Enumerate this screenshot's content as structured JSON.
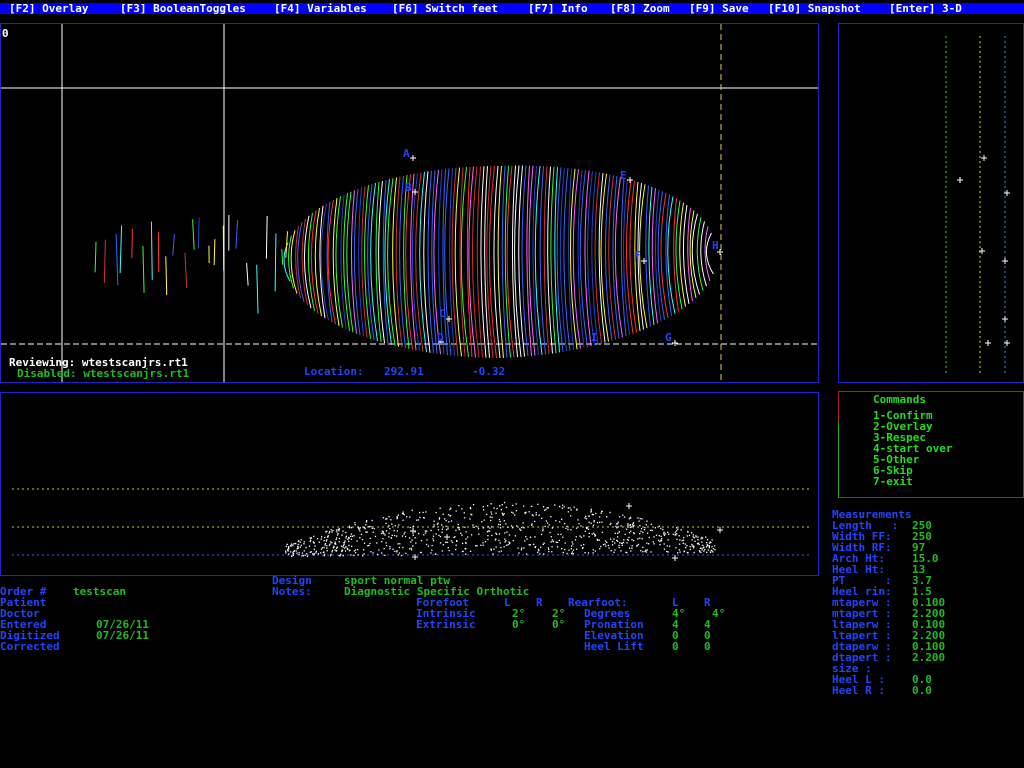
{
  "menu": [
    {
      "key": "f2",
      "label": "[F2] Overlay"
    },
    {
      "key": "f3",
      "label": "[F3] BooleanToggles"
    },
    {
      "key": "f4",
      "label": "[F4] Variables"
    },
    {
      "key": "f6",
      "label": "[F6] Switch feet"
    },
    {
      "key": "f7",
      "label": "[F7] Info"
    },
    {
      "key": "f8",
      "label": "[F8] Zoom"
    },
    {
      "key": "f9",
      "label": "[F9] Save"
    },
    {
      "key": "f10",
      "label": "[F10] Snapshot"
    },
    {
      "key": "enter",
      "label": "[Enter] 3-D"
    }
  ],
  "viewport": {
    "corner_label": "0",
    "reviewing": "Reviewing: wtestscanjrs.rt1",
    "disabled": "Disabled: wtestscanjrs.rt1",
    "location_label": "Location:",
    "location_x": "292.91",
    "location_y": "-0.32",
    "markers": [
      "A",
      "B",
      "C",
      "D",
      "E",
      "F",
      "G",
      "H",
      "I"
    ]
  },
  "commands": {
    "title": "Commands",
    "items": [
      "1-Confirm",
      "2-Overlay",
      "3-Respec",
      "4-start over",
      "5-Other",
      "6-Skip",
      "7-exit"
    ]
  },
  "measurements": {
    "title": "Measurements",
    "rows": [
      {
        "label": "Length   :",
        "value": "250"
      },
      {
        "label": "Width FF:",
        "value": "250"
      },
      {
        "label": "Width RF:",
        "value": "97"
      },
      {
        "label": "Arch Ht:",
        "value": "15.0"
      },
      {
        "label": "Heel Ht:",
        "value": "13"
      },
      {
        "label": "PT      :",
        "value": "3.7"
      },
      {
        "label": "Heel rin:",
        "value": "1.5"
      },
      {
        "label": "mtaperw :",
        "value": "0.100"
      },
      {
        "label": "mtapert :",
        "value": "2.200"
      },
      {
        "label": "ltaperw :",
        "value": "0.100"
      },
      {
        "label": "ltapert :",
        "value": "2.200"
      },
      {
        "label": "dtaperw :",
        "value": "0.100"
      },
      {
        "label": "dtapert :",
        "value": "2.200"
      },
      {
        "label": "size :",
        "value": ""
      },
      {
        "label": "Heel L :",
        "value": "0.0"
      },
      {
        "label": "Heel R :",
        "value": "0.0"
      }
    ]
  },
  "order": {
    "order_label": "Order #",
    "order_value": "testscan",
    "patient_label": "Patient",
    "doctor_label": "Doctor",
    "entered_label": "Entered",
    "entered_value": "07/26/11",
    "digitized_label": "Digitized",
    "digitized_value": "07/26/11",
    "corrected_label": "Corrected"
  },
  "design": {
    "design_label": "Design",
    "design_value": "sport normal ptw",
    "notes_label": "Notes:",
    "notes_value": "Diagnostic Specific Orthotic"
  },
  "posting": {
    "forefoot_label": "Forefoot",
    "L": "L",
    "R": "R",
    "intrinsic_label": "Intrinsic",
    "intrinsic_L": "2°",
    "intrinsic_R": "2°",
    "extrinsic_label": "Extrinsic",
    "extrinsic_L": "0°",
    "extrinsic_R": "0°",
    "rearfoot_label": "Rearfoot:",
    "degrees_label": "Degrees",
    "degrees_L": "4°",
    "degrees_R": "4°",
    "pronation_label": "Pronation",
    "pronation_L": "4",
    "pronation_R": "4",
    "elevation_label": "Elevation",
    "elevation_L": "0",
    "elevation_R": "0",
    "heellift_label": "Heel Lift",
    "heellift_L": "0",
    "heellift_R": "0"
  }
}
